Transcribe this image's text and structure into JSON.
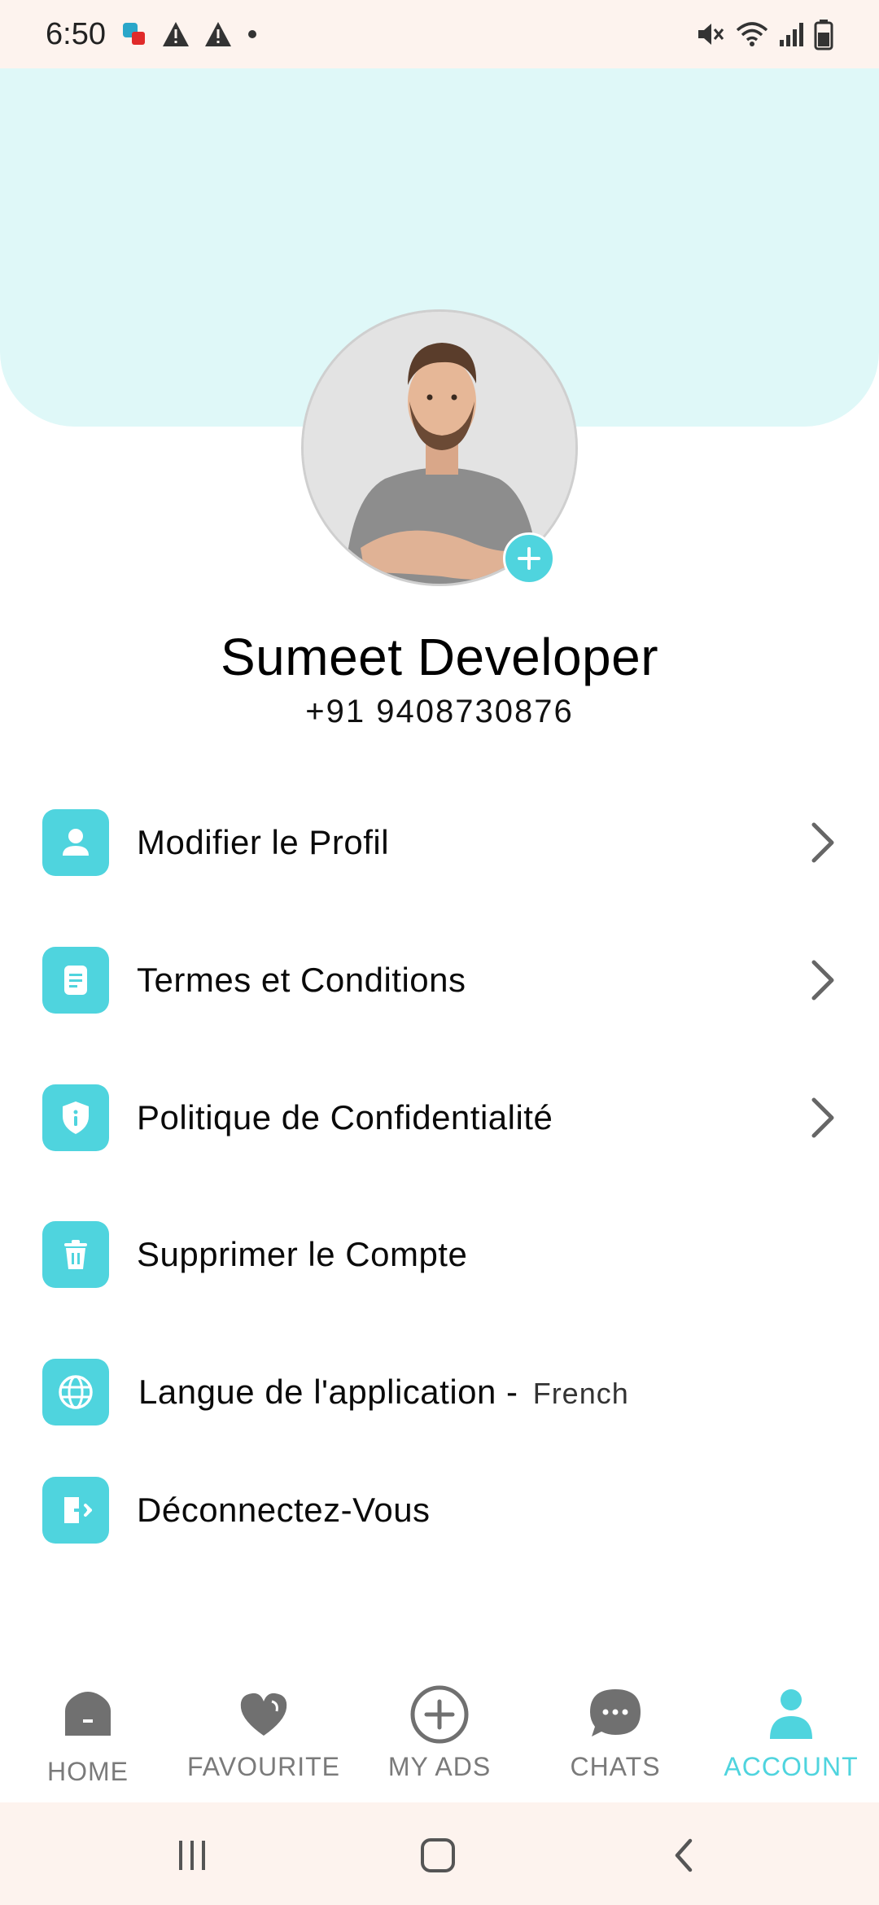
{
  "status_bar": {
    "time": "6:50"
  },
  "profile": {
    "name": "Sumeet Developer",
    "phone": "+91 9408730876"
  },
  "menu": {
    "items": [
      {
        "label": "Modifier le Profil",
        "icon": "person-icon",
        "has_chevron": true
      },
      {
        "label": "Termes et Conditions",
        "icon": "document-icon",
        "has_chevron": true
      },
      {
        "label": "Politique de Confidentialité",
        "icon": "shield-icon",
        "has_chevron": true
      },
      {
        "label": "Supprimer le Compte",
        "icon": "trash-icon",
        "has_chevron": false
      },
      {
        "label": "Langue de l'application - ",
        "sub": "French",
        "icon": "globe-icon",
        "has_chevron": false
      },
      {
        "label": "Déconnectez-Vous",
        "icon": "logout-icon",
        "has_chevron": false
      }
    ]
  },
  "bottom_nav": {
    "items": [
      {
        "label": "HOME",
        "icon": "home-icon"
      },
      {
        "label": "FAVOURITE",
        "icon": "heart-icon"
      },
      {
        "label": "MY ADS",
        "icon": "add-circle-icon"
      },
      {
        "label": "CHATS",
        "icon": "chat-icon"
      },
      {
        "label": "ACCOUNT",
        "icon": "account-icon",
        "active": true
      }
    ]
  },
  "colors": {
    "accent": "#4fd4de",
    "header_bg": "#dff8f8",
    "system_bar_bg": "#fdf3ee",
    "inactive": "#7a7a7a"
  }
}
